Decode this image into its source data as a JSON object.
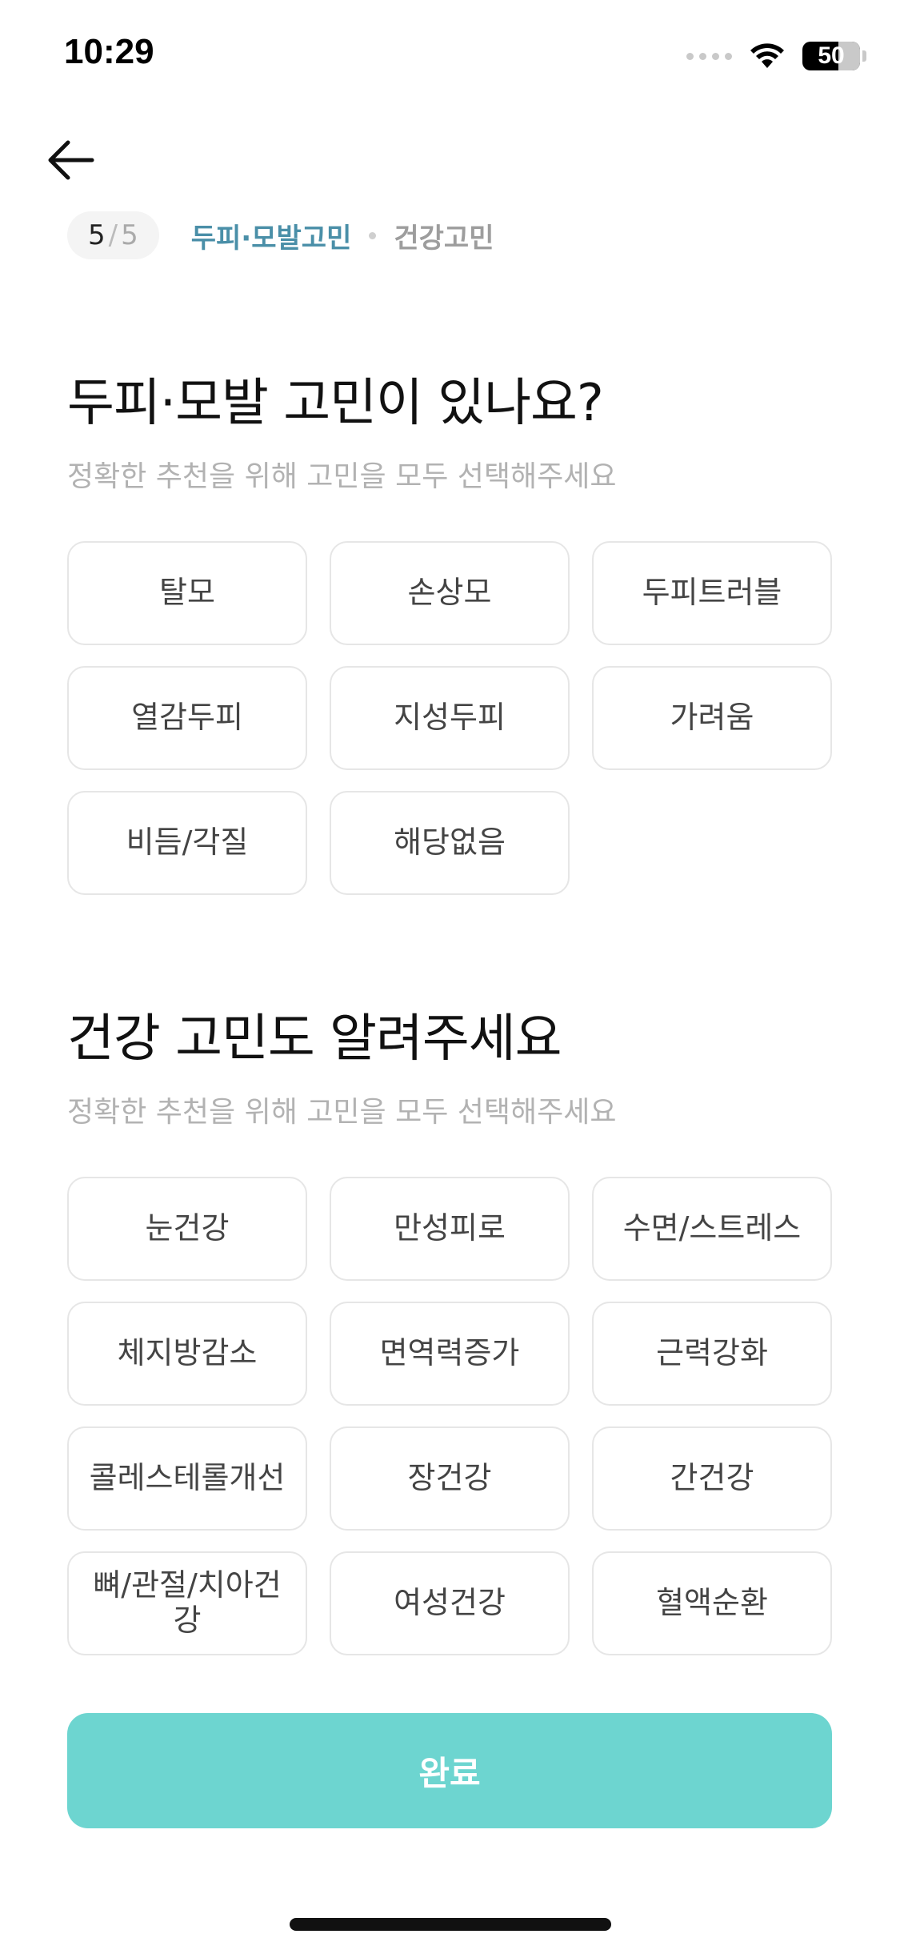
{
  "status_bar": {
    "time": "10:29",
    "battery": "50"
  },
  "progress": {
    "current": "5",
    "separator": "/",
    "total": "5",
    "active_label": "두피·모발고민",
    "next_label": "건강고민"
  },
  "scalp_section": {
    "title": "두피·모발 고민이 있나요?",
    "subtitle": "정확한 추천을 위해 고민을 모두 선택해주세요",
    "options": [
      "탈모",
      "손상모",
      "두피트러블",
      "열감두피",
      "지성두피",
      "가려움",
      "비듬/각질",
      "해당없음"
    ]
  },
  "health_section": {
    "title": "건강 고민도 알려주세요",
    "subtitle": "정확한 추천을 위해 고민을 모두 선택해주세요",
    "options": [
      "눈건강",
      "만성피로",
      "수면/스트레스",
      "체지방감소",
      "면역력증가",
      "근력강화",
      "콜레스테롤개선",
      "장건강",
      "간건강",
      "뼈/관절/치아건강",
      "여성건강",
      "혈액순환"
    ]
  },
  "footer": {
    "complete_label": "완료"
  },
  "colors": {
    "accent": "#6dd5d0",
    "breadcrumb_active": "#4a8fa8"
  }
}
